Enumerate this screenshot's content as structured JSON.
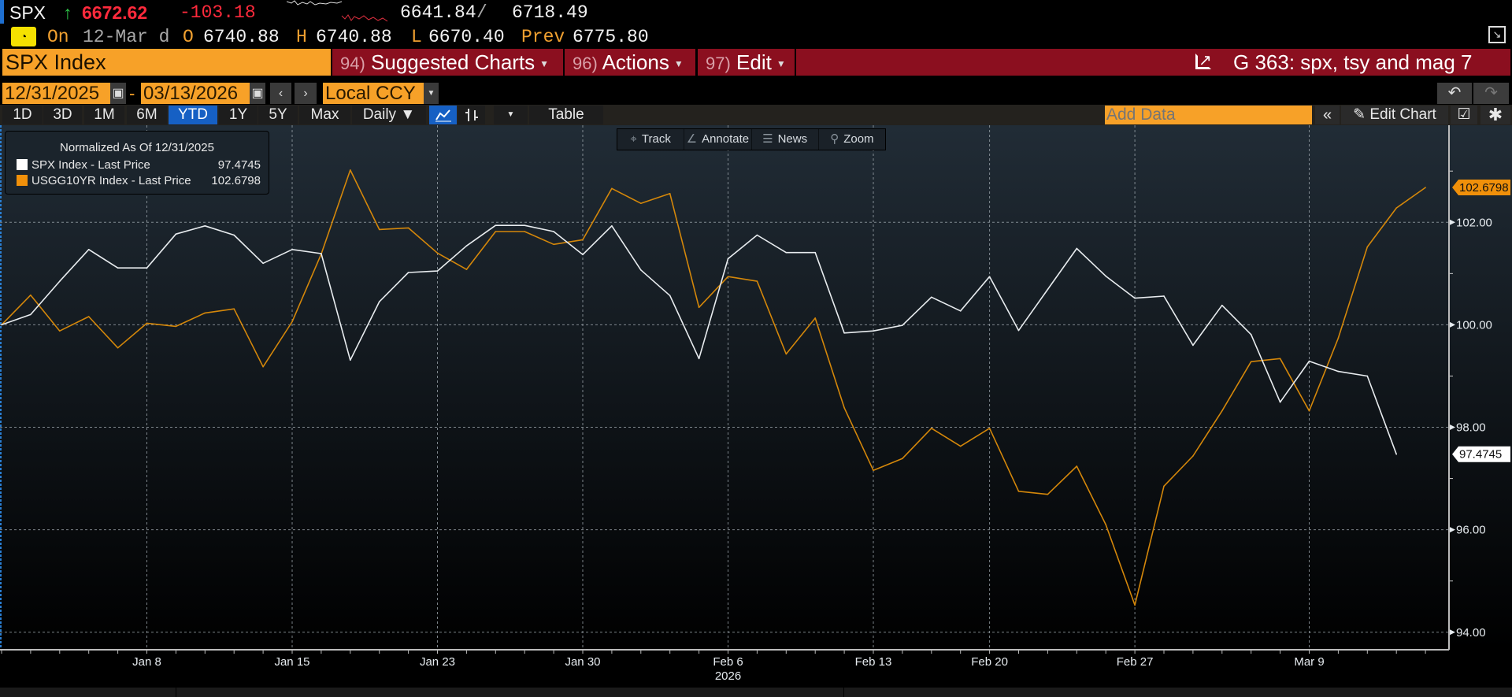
{
  "ticker": {
    "symbol": "SPX",
    "direction_icon": "up-arrow-icon",
    "last": "6672.62",
    "change": "-103.18",
    "bid": "6641.84",
    "separator": "/",
    "ask": "6718.49",
    "on_label": "On",
    "date": "12-Mar d",
    "open_label": "O",
    "open": "6740.88",
    "high_label": "H",
    "high": "6740.88",
    "low_label": "L",
    "low": "6670.40",
    "prev_label": "Prev",
    "prev": "6775.80"
  },
  "command_bar": {
    "security": "SPX Index",
    "menus": [
      {
        "num": "94)",
        "label": "Suggested Charts"
      },
      {
        "num": "96)",
        "label": "Actions"
      },
      {
        "num": "97)",
        "label": "Edit"
      }
    ],
    "chart_name": "G 363: spx, tsy and mag 7"
  },
  "date_range": {
    "start": "12/31/2025",
    "dash": "-",
    "end": "03/13/2026",
    "currency": "Local CCY"
  },
  "toolbar": {
    "periods": [
      "1D",
      "3D",
      "1M",
      "6M",
      "YTD",
      "1Y",
      "5Y",
      "Max"
    ],
    "active_period": "YTD",
    "frequency": "Daily ▼",
    "table_label": "Table",
    "add_data_placeholder": "Add Data",
    "edit_chart_label": "Edit Chart"
  },
  "chart_tools": [
    "Track",
    "Annotate",
    "News",
    "Zoom"
  ],
  "colors": {
    "spx": "#e8ecef",
    "usgg": "#d4870a",
    "accent_orange": "#f7a128",
    "bar_red": "#8b0f1f",
    "active_blue": "#1660c4"
  },
  "chart_data": {
    "type": "line",
    "title": "Normalized As Of 12/31/2025",
    "x": [
      "12/31",
      "01/02",
      "01/05",
      "01/06",
      "01/07",
      "01/08",
      "01/09",
      "01/12",
      "01/13",
      "01/14",
      "01/15",
      "01/16",
      "01/20",
      "01/21",
      "01/22",
      "01/23",
      "01/26",
      "01/27",
      "01/28",
      "01/29",
      "01/30",
      "02/02",
      "02/03",
      "02/04",
      "02/05",
      "02/06",
      "02/09",
      "02/10",
      "02/11",
      "02/12",
      "02/13",
      "02/17",
      "02/18",
      "02/19",
      "02/20",
      "02/23",
      "02/24",
      "02/25",
      "02/26",
      "02/27",
      "03/02",
      "03/03",
      "03/04",
      "03/05",
      "03/06",
      "03/09",
      "03/10",
      "03/11",
      "03/12",
      "03/13"
    ],
    "x_ticks": [
      {
        "label": "Jan 8",
        "index": 5
      },
      {
        "label": "Jan 15",
        "index": 10
      },
      {
        "label": "Jan 23",
        "index": 15
      },
      {
        "label": "Jan 30",
        "index": 20
      },
      {
        "label": "Feb 6",
        "index": 25
      },
      {
        "label": "Feb 13",
        "index": 30
      },
      {
        "label": "Feb 20",
        "index": 34
      },
      {
        "label": "Feb 27",
        "index": 39
      },
      {
        "label": "Mar 9",
        "index": 45
      }
    ],
    "year_label": "2026",
    "year_label_index": 25,
    "y_ticks": [
      "94.00",
      "96.00",
      "98.00",
      "100.00",
      "102.00"
    ],
    "ylim": [
      93.7,
      103.8
    ],
    "grid": true,
    "legend_placement": "top-left",
    "series": [
      {
        "name": "SPX Index - Last Price",
        "last": "97.4745",
        "color": "#e8ecef",
        "values": [
          100.0,
          100.2,
          100.85,
          101.47,
          101.11,
          101.11,
          101.77,
          101.93,
          101.75,
          101.2,
          101.47,
          101.39,
          99.31,
          100.45,
          101.02,
          101.05,
          101.54,
          101.94,
          101.94,
          101.82,
          101.37,
          101.93,
          101.07,
          100.57,
          99.34,
          101.29,
          101.75,
          101.41,
          101.41,
          99.84,
          99.88,
          99.99,
          100.54,
          100.27,
          100.94,
          99.89,
          100.69,
          101.49,
          100.95,
          100.52,
          100.56,
          99.6,
          100.38,
          99.81,
          98.49,
          99.29,
          99.09,
          99.0,
          97.4745
        ]
      },
      {
        "name": "USGG10YR Index - Last Price",
        "last": "102.6798",
        "color": "#d4870a",
        "values": [
          100.0,
          100.58,
          99.88,
          100.16,
          99.55,
          100.03,
          99.97,
          100.23,
          100.31,
          99.18,
          100.06,
          101.38,
          103.02,
          101.86,
          101.89,
          101.4,
          101.08,
          101.82,
          101.82,
          101.57,
          101.66,
          102.66,
          102.37,
          102.56,
          100.34,
          100.94,
          100.85,
          99.43,
          100.13,
          98.38,
          97.16,
          97.39,
          97.98,
          97.63,
          97.98,
          96.75,
          96.69,
          97.24,
          96.1,
          94.53,
          96.85,
          97.44,
          98.32,
          99.28,
          99.34,
          98.32,
          99.74,
          101.52,
          102.28,
          102.6798
        ]
      }
    ]
  }
}
